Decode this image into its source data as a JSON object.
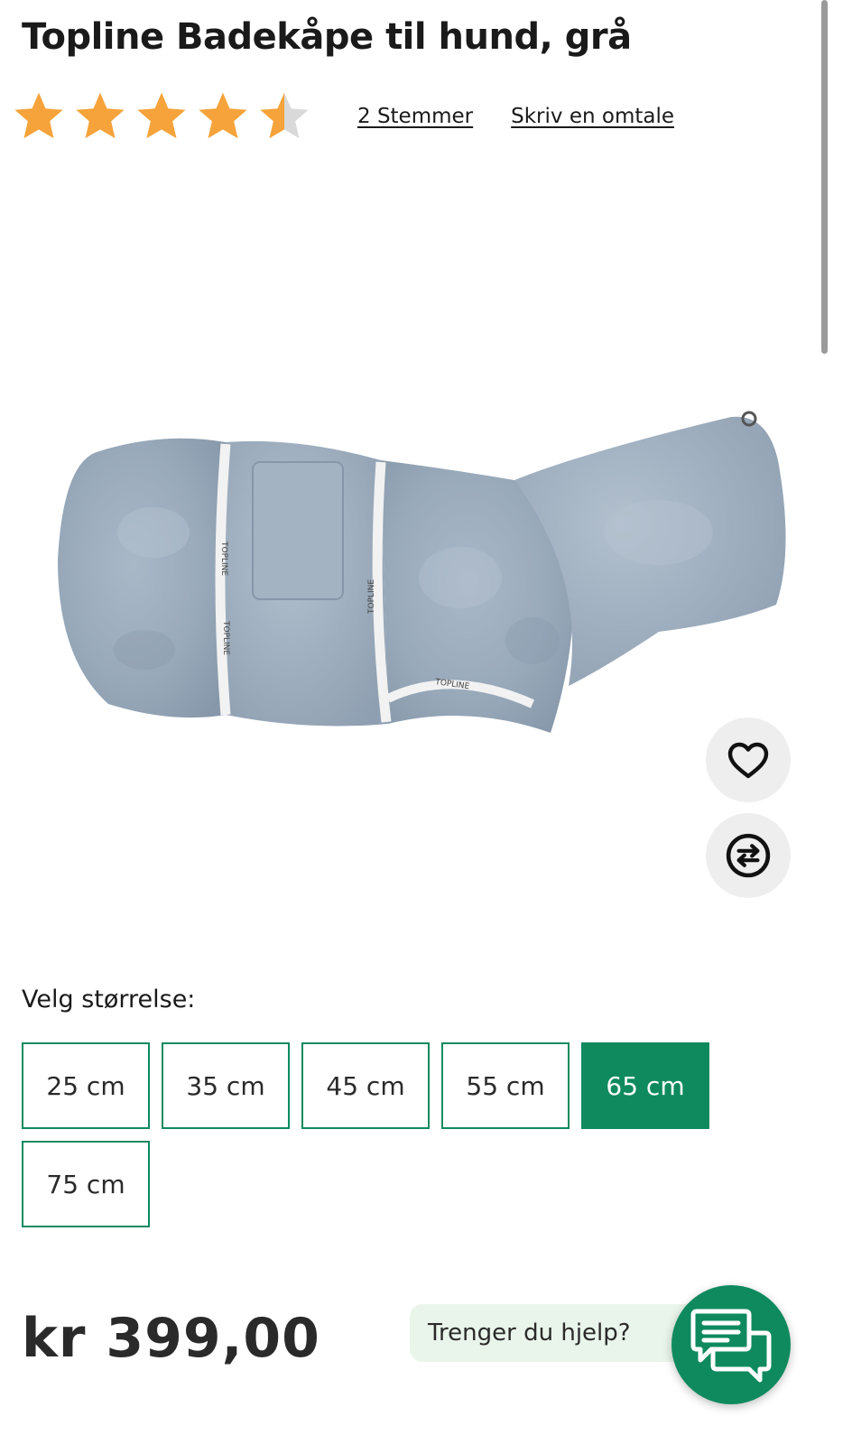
{
  "product": {
    "title": "Topline Badekåpe til hund, grå",
    "rating": 4.5,
    "rating_max": 5,
    "votes_label": "2 Stemmer",
    "review_label": "Skriv en omtale",
    "image_alt": "Grå badekåpe for hund",
    "image_brand_text": "TOPLINE"
  },
  "size_selector": {
    "label": "Velg størrelse:",
    "options": [
      "25 cm",
      "35 cm",
      "45 cm",
      "55 cm",
      "65 cm",
      "75 cm"
    ],
    "selected": "65 cm"
  },
  "price": {
    "label": "kr 399,00"
  },
  "help": {
    "label": "Trenger du hjelp?"
  },
  "icons": {
    "wishlist": "heart-icon",
    "compare": "compare-arrows-icon",
    "chat": "chat-icon",
    "star": "star-icon"
  },
  "colors": {
    "accent": "#0f8a5f",
    "star": "#f5a33a",
    "star_empty": "#d9d9d9",
    "help_bubble": "#e9f5ea"
  }
}
